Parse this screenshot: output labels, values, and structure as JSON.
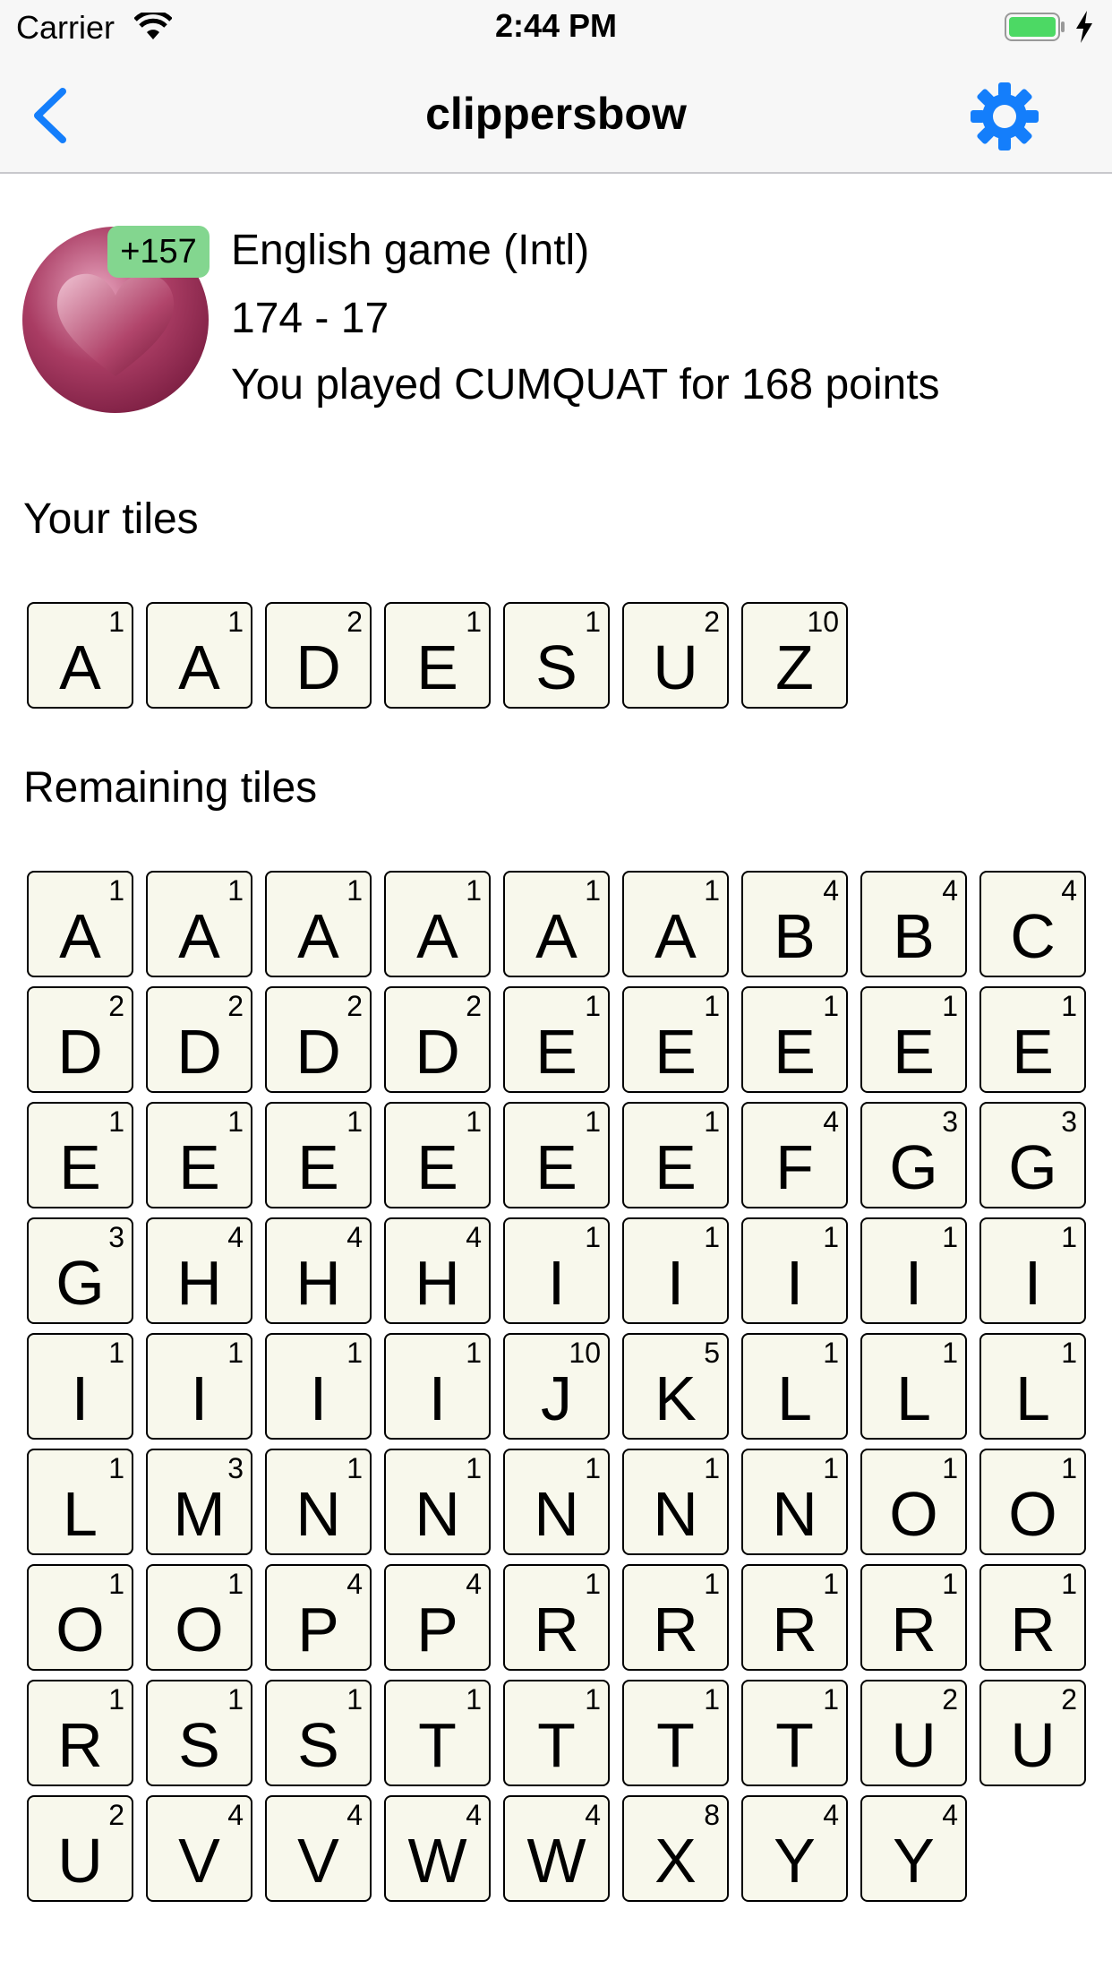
{
  "status_bar": {
    "carrier": "Carrier",
    "time": "2:44 PM",
    "wifi_icon": "wifi-icon",
    "battery_icon": "battery-charging-icon"
  },
  "nav": {
    "title": "clippersbow",
    "back_icon": "chevron-left-icon",
    "settings_icon": "gear-icon"
  },
  "game": {
    "badge": "+157",
    "avatar_icon": "heart-icon",
    "language": "English game (Intl)",
    "score": "174 - 17",
    "last_move": "You played CUMQUAT for 168 points"
  },
  "sections": {
    "your_tiles": "Your tiles",
    "remaining_tiles": "Remaining tiles"
  },
  "your_tiles": [
    {
      "letter": "A",
      "value": "1"
    },
    {
      "letter": "A",
      "value": "1"
    },
    {
      "letter": "D",
      "value": "2"
    },
    {
      "letter": "E",
      "value": "1"
    },
    {
      "letter": "S",
      "value": "1"
    },
    {
      "letter": "U",
      "value": "2"
    },
    {
      "letter": "Z",
      "value": "10"
    }
  ],
  "remaining_tiles": [
    {
      "letter": "A",
      "value": "1"
    },
    {
      "letter": "A",
      "value": "1"
    },
    {
      "letter": "A",
      "value": "1"
    },
    {
      "letter": "A",
      "value": "1"
    },
    {
      "letter": "A",
      "value": "1"
    },
    {
      "letter": "A",
      "value": "1"
    },
    {
      "letter": "B",
      "value": "4"
    },
    {
      "letter": "B",
      "value": "4"
    },
    {
      "letter": "C",
      "value": "4"
    },
    {
      "letter": "D",
      "value": "2"
    },
    {
      "letter": "D",
      "value": "2"
    },
    {
      "letter": "D",
      "value": "2"
    },
    {
      "letter": "D",
      "value": "2"
    },
    {
      "letter": "E",
      "value": "1"
    },
    {
      "letter": "E",
      "value": "1"
    },
    {
      "letter": "E",
      "value": "1"
    },
    {
      "letter": "E",
      "value": "1"
    },
    {
      "letter": "E",
      "value": "1"
    },
    {
      "letter": "E",
      "value": "1"
    },
    {
      "letter": "E",
      "value": "1"
    },
    {
      "letter": "E",
      "value": "1"
    },
    {
      "letter": "E",
      "value": "1"
    },
    {
      "letter": "E",
      "value": "1"
    },
    {
      "letter": "E",
      "value": "1"
    },
    {
      "letter": "F",
      "value": "4"
    },
    {
      "letter": "G",
      "value": "3"
    },
    {
      "letter": "G",
      "value": "3"
    },
    {
      "letter": "G",
      "value": "3"
    },
    {
      "letter": "H",
      "value": "4"
    },
    {
      "letter": "H",
      "value": "4"
    },
    {
      "letter": "H",
      "value": "4"
    },
    {
      "letter": "I",
      "value": "1"
    },
    {
      "letter": "I",
      "value": "1"
    },
    {
      "letter": "I",
      "value": "1"
    },
    {
      "letter": "I",
      "value": "1"
    },
    {
      "letter": "I",
      "value": "1"
    },
    {
      "letter": "I",
      "value": "1"
    },
    {
      "letter": "I",
      "value": "1"
    },
    {
      "letter": "I",
      "value": "1"
    },
    {
      "letter": "I",
      "value": "1"
    },
    {
      "letter": "J",
      "value": "10"
    },
    {
      "letter": "K",
      "value": "5"
    },
    {
      "letter": "L",
      "value": "1"
    },
    {
      "letter": "L",
      "value": "1"
    },
    {
      "letter": "L",
      "value": "1"
    },
    {
      "letter": "L",
      "value": "1"
    },
    {
      "letter": "M",
      "value": "3"
    },
    {
      "letter": "N",
      "value": "1"
    },
    {
      "letter": "N",
      "value": "1"
    },
    {
      "letter": "N",
      "value": "1"
    },
    {
      "letter": "N",
      "value": "1"
    },
    {
      "letter": "N",
      "value": "1"
    },
    {
      "letter": "O",
      "value": "1"
    },
    {
      "letter": "O",
      "value": "1"
    },
    {
      "letter": "O",
      "value": "1"
    },
    {
      "letter": "O",
      "value": "1"
    },
    {
      "letter": "P",
      "value": "4"
    },
    {
      "letter": "P",
      "value": "4"
    },
    {
      "letter": "R",
      "value": "1"
    },
    {
      "letter": "R",
      "value": "1"
    },
    {
      "letter": "R",
      "value": "1"
    },
    {
      "letter": "R",
      "value": "1"
    },
    {
      "letter": "R",
      "value": "1"
    },
    {
      "letter": "R",
      "value": "1"
    },
    {
      "letter": "S",
      "value": "1"
    },
    {
      "letter": "S",
      "value": "1"
    },
    {
      "letter": "T",
      "value": "1"
    },
    {
      "letter": "T",
      "value": "1"
    },
    {
      "letter": "T",
      "value": "1"
    },
    {
      "letter": "T",
      "value": "1"
    },
    {
      "letter": "U",
      "value": "2"
    },
    {
      "letter": "U",
      "value": "2"
    },
    {
      "letter": "U",
      "value": "2"
    },
    {
      "letter": "V",
      "value": "4"
    },
    {
      "letter": "V",
      "value": "4"
    },
    {
      "letter": "W",
      "value": "4"
    },
    {
      "letter": "W",
      "value": "4"
    },
    {
      "letter": "X",
      "value": "8"
    },
    {
      "letter": "Y",
      "value": "4"
    },
    {
      "letter": "Y",
      "value": "4"
    }
  ],
  "colors": {
    "accent": "#147efb",
    "badge": "#83d68f",
    "tile_bg": "#f8f8ec",
    "avatar": "#9b2f55"
  }
}
